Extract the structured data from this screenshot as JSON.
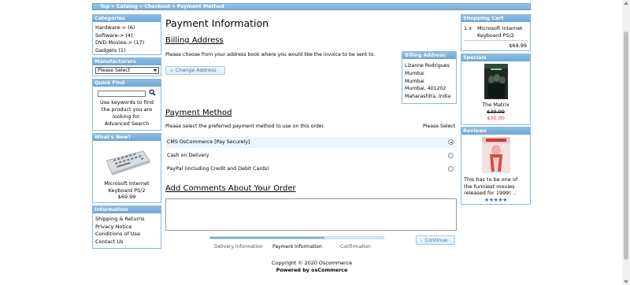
{
  "breadcrumb": "Top » Catalog » Checkout » Payment Method",
  "categories": {
    "title": "Categories",
    "items": [
      "Hardware-> (6)",
      "Software-> (4)",
      "DVD Movies-> (17)",
      "Gadgets (1)"
    ]
  },
  "manufacturers": {
    "title": "Manufacturers",
    "select_value": "Please Select"
  },
  "quick_find": {
    "title": "Quick Find",
    "hint_line1": "Use keywords to find",
    "hint_line2": "the product you are",
    "hint_line3": "looking for.",
    "advanced": "Advanced Search"
  },
  "whats_new": {
    "title": "What's New?",
    "product_line1": "Microsoft Internet",
    "product_line2": "Keyboard PS/2",
    "price": "$69.99"
  },
  "information": {
    "title": "Information",
    "links": [
      "Shipping & Returns",
      "Privacy Notice",
      "Conditions of Use",
      "Contact Us"
    ]
  },
  "main": {
    "title": "Payment Information",
    "billing_heading": "Billing Address",
    "billing_text": "Please choose from your address book where you would like the invoice to be sent to.",
    "change_address": "Change Address",
    "billing_box_title": "Billing Address:",
    "billing_lines": [
      "Lizanne Rodrigues",
      "Mumbai",
      "Mumbai",
      "Mumbai, 401202",
      "Maharashtra, India"
    ],
    "payment_heading": "Payment Method",
    "payment_text": "Please select the preferred payment method to use on this order.",
    "please_select": "Please Select",
    "methods": [
      "CMS OsCommerce [Pay Securely]",
      "Cash on Delivery",
      "PayPal (including Credit and Debit Cards)"
    ],
    "selected_method_index": 0,
    "comments_heading": "Add Comments About Your Order",
    "continue_label": "Continue",
    "progress_fraction": 0.66,
    "steps": [
      "Delivery Information",
      "Payment Information",
      "Confirmation"
    ]
  },
  "footer": {
    "copyright": "Copyright © 2020 Oscommerce",
    "powered": "Powered by osCommerce"
  },
  "cart": {
    "title": "Shopping Cart",
    "qty": "1 x",
    "item_line1": "Microsoft Internet",
    "item_line2": "Keyboard PS/2",
    "total": "$69.99"
  },
  "specials": {
    "title": "Specials",
    "product": "The Matrix",
    "old_price": "$39.99",
    "new_price": "$30.00"
  },
  "reviews": {
    "title": "Reviews",
    "text_line1": "This has to be one of",
    "text_line2": "the funniest movies",
    "text_line3": "released for 1999! ..",
    "rating": 5
  },
  "colors": {
    "header_blue": "#7aaed9",
    "link_blue": "#3a6ea5",
    "special_red": "#e0303a"
  }
}
